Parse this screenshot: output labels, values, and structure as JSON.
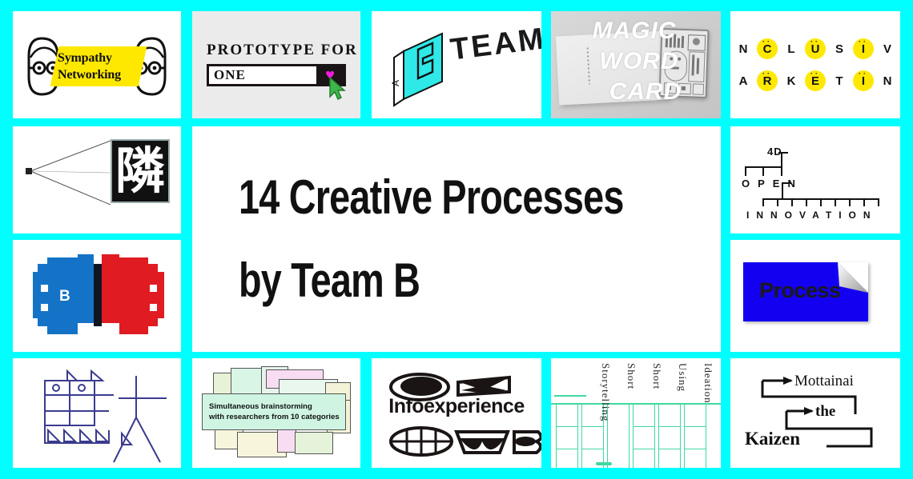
{
  "board": {
    "background_color": "#00FFFF",
    "title": "14 Creative Processes by Team B"
  },
  "hero": {
    "line1": "14 Creative Processes",
    "line2": "by Team B"
  },
  "tiles": [
    {
      "id": "sympathy-networking",
      "label_line1": "Sympathy",
      "label_line2": "Networking",
      "highlight_color": "#FFE800",
      "background_color": "#FFFFFF"
    },
    {
      "id": "prototype-for-one",
      "title": "PROTOTYPE FOR",
      "input_value": "ONE",
      "button_icon": "heart-icon",
      "heart_color": "#F21BE0",
      "cursor_color": "#3DB54A",
      "background_color": "#EBEBEB"
    },
    {
      "id": "b-team",
      "word": "TEAM.",
      "mark_letters": "AB",
      "accent_color": "#2FE8E8",
      "background_color": "#FFFFFF"
    },
    {
      "id": "magic-word-card",
      "line1": "MAGIC",
      "line2": "WORD",
      "line3": "CARD",
      "background_color": "#CFCFCF"
    },
    {
      "id": "inclusive-marketing",
      "word1": "INCLUSIVE",
      "word2": "MARKETING",
      "dot_indices_row1": [
        0,
        2,
        4,
        6,
        8
      ],
      "dot_indices_row2": [
        0,
        2,
        4,
        6,
        8
      ],
      "dot_color": "#FFE800",
      "background_color": "#FFFFFF"
    },
    {
      "id": "tonari-kanji",
      "kanji": "隣",
      "background_color": "#FFFFFF"
    },
    {
      "id": "hero-title",
      "background_color": "#FFFFFF"
    },
    {
      "id": "4d-open-innovation",
      "top": "4D",
      "middle": "OPEN",
      "bottom": "INNOVATION",
      "background_color": "#FFFFFF"
    },
    {
      "id": "pixel-faces",
      "letter": "B",
      "left_color": "#1473C6",
      "right_color": "#E01B22",
      "background_color": "#FFFFFF"
    },
    {
      "id": "process-card",
      "label": "Process",
      "card_color": "#1400F0",
      "background_color": "#FFFFFF"
    },
    {
      "id": "line-art-kanji",
      "stroke_color": "#3B3B8F",
      "background_color": "#FFFFFF"
    },
    {
      "id": "simultaneous-brainstorming",
      "text_line1": "Simultaneous brainstorming",
      "text_line2": "with researchers from 10 categories",
      "bubble_colors": [
        "#CFF5E2",
        "#F7DDF2",
        "#F5F3D7",
        "#E4F3D9",
        "#E9F7EE"
      ],
      "background_color": "#FFFFFF"
    },
    {
      "id": "infoexperience",
      "word": "Infoexperience",
      "background_color": "#FFFFFF"
    },
    {
      "id": "short-short-storytelling",
      "col1": "Ideation",
      "col2": "Using",
      "col3": "Short",
      "col4": "Short",
      "col5": "Storytelling",
      "grid_color": "#3FD9A0",
      "background_color": "#FFFFFF"
    },
    {
      "id": "mottainai-kaizen",
      "word1": "Mottainai",
      "word2": "the",
      "word3": "Kaizen",
      "background_color": "#FFFFFF"
    }
  ]
}
